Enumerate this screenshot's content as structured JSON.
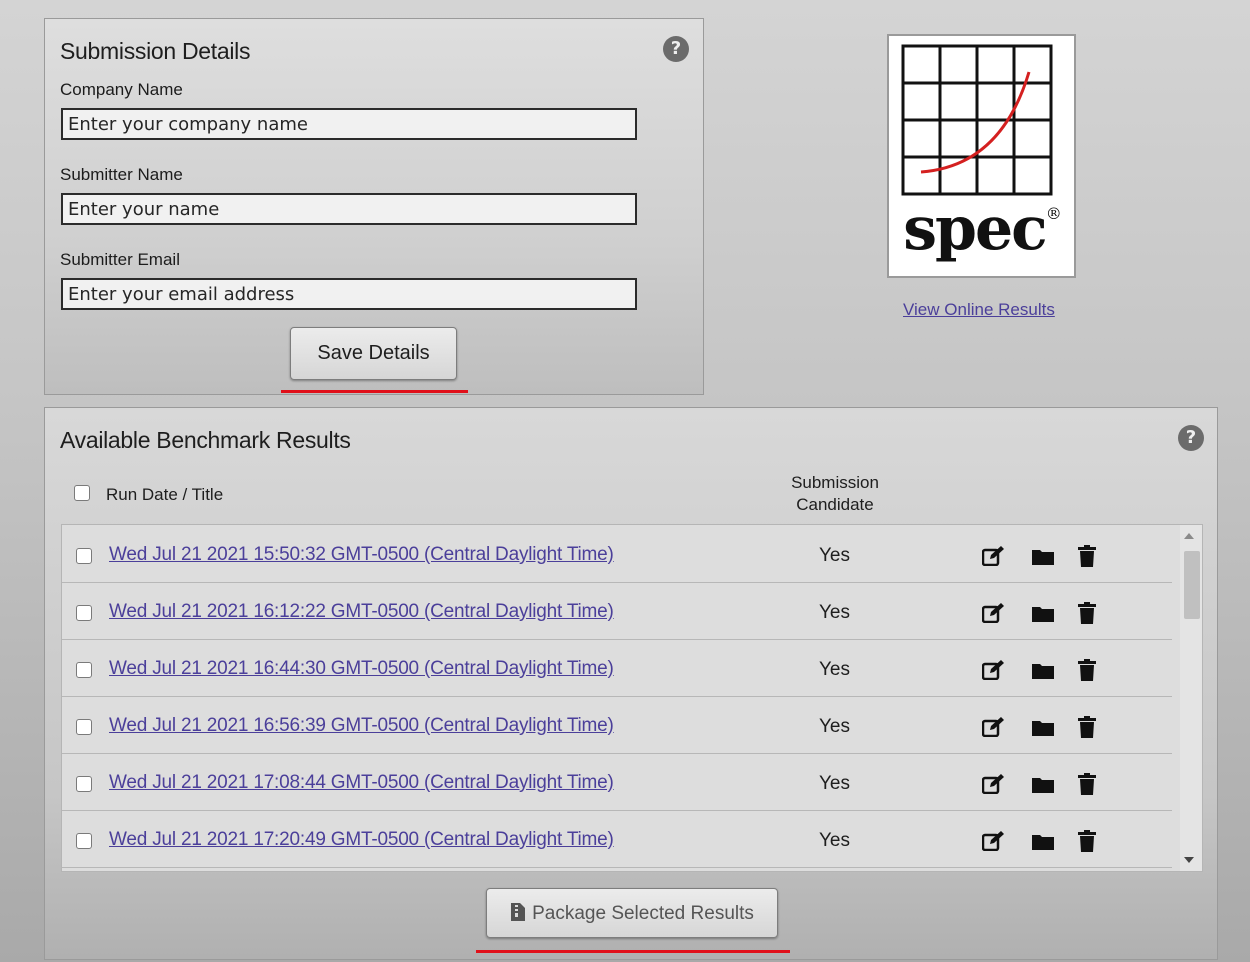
{
  "submission": {
    "title": "Submission Details",
    "help": "?",
    "company_label": "Company Name",
    "company_placeholder": "Enter your company name",
    "submitter_label": "Submitter Name",
    "submitter_placeholder": "Enter your name",
    "email_label": "Submitter Email",
    "email_placeholder": "Enter your email address",
    "save_label": "Save Details"
  },
  "logo": {
    "word": "spec",
    "mark": "®"
  },
  "view_online": "View Online Results",
  "results": {
    "title": "Available Benchmark Results",
    "help": "?",
    "col_run": "Run Date / Title",
    "col_candidate_line1": "Submission",
    "col_candidate_line2": "Candidate",
    "rows": [
      {
        "title": "Wed Jul 21 2021 15:50:32 GMT-0500 (Central Daylight Time)",
        "candidate": "Yes"
      },
      {
        "title": "Wed Jul 21 2021 16:12:22 GMT-0500 (Central Daylight Time)",
        "candidate": "Yes"
      },
      {
        "title": "Wed Jul 21 2021 16:44:30 GMT-0500 (Central Daylight Time)",
        "candidate": "Yes"
      },
      {
        "title": "Wed Jul 21 2021 16:56:39 GMT-0500 (Central Daylight Time)",
        "candidate": "Yes"
      },
      {
        "title": "Wed Jul 21 2021 17:08:44 GMT-0500 (Central Daylight Time)",
        "candidate": "Yes"
      },
      {
        "title": "Wed Jul 21 2021 17:20:49 GMT-0500 (Central Daylight Time)",
        "candidate": "Yes"
      }
    ],
    "row_icons": [
      "edit-icon",
      "folder-icon",
      "trash-icon"
    ],
    "package_label": "Package Selected Results"
  },
  "colors": {
    "link": "#4b3f9a",
    "highlight_underline": "#e0101a",
    "logo_curve": "#d42020"
  }
}
